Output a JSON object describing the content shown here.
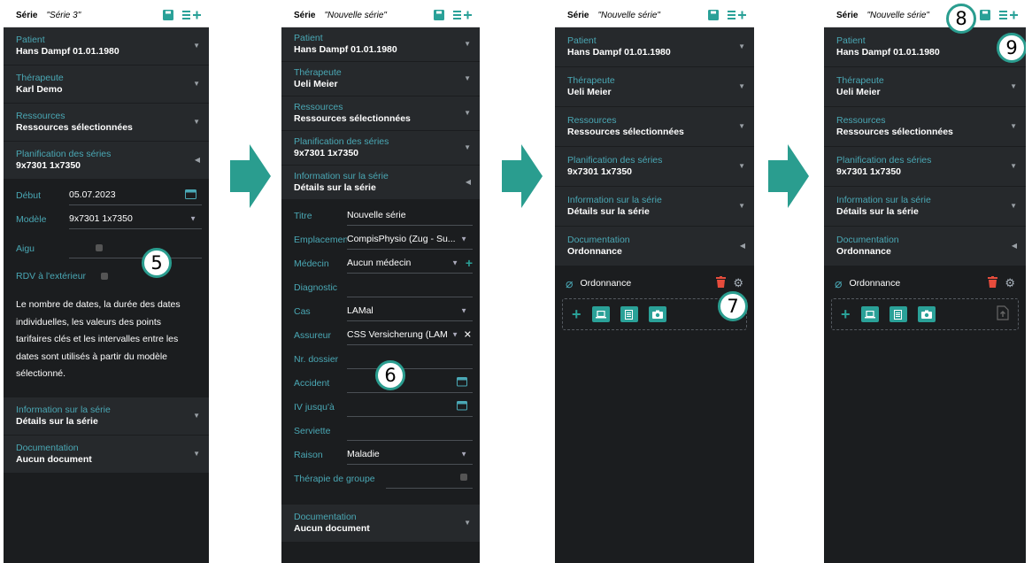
{
  "series_label": "Série",
  "panels": {
    "p1": {
      "series_name": "\"Série 3\"",
      "patient": {
        "title": "Patient",
        "value": "Hans Dampf   01.01.1980"
      },
      "therapist": {
        "title": "Thérapeute",
        "value": "Karl Demo"
      },
      "resources": {
        "title": "Ressources",
        "value": "Ressources sélectionnées"
      },
      "planning": {
        "title": "Planification des séries",
        "value": "9x7301 1x7350"
      },
      "start": {
        "label": "Début",
        "value": "05.07.2023"
      },
      "model": {
        "label": "Modèle",
        "value": "9x7301 1x7350"
      },
      "acute": {
        "label": "Aigu"
      },
      "outside": {
        "label": "RDV à l'extérieur"
      },
      "description": "Le nombre de dates, la durée des dates individuelles, les valeurs des points tarifaires clés et les intervalles entre les dates sont utilisés à partir du modèle sélectionné.",
      "info": {
        "title": "Information sur la série",
        "value": "Détails sur la série"
      },
      "documentation": {
        "title": "Documentation",
        "value": "Aucun document"
      },
      "badge": "5"
    },
    "p2": {
      "series_name": "\"Nouvelle série\"",
      "patient": {
        "title": "Patient",
        "value": "Hans Dampf   01.01.1980"
      },
      "therapist": {
        "title": "Thérapeute",
        "value": "Ueli  Meier"
      },
      "resources": {
        "title": "Ressources",
        "value": "Ressources sélectionnées"
      },
      "planning": {
        "title": "Planification des séries",
        "value": "9x7301 1x7350"
      },
      "info": {
        "title": "Information sur la série",
        "value": "Détails sur la série"
      },
      "fields": [
        {
          "label": "Titre",
          "value": "Nouvelle série"
        },
        {
          "label": "Emplacement",
          "value": "CompisPhysio (Zug - Su..."
        },
        {
          "label": "Médecin",
          "value": "Aucun médecin"
        },
        {
          "label": "Diagnostic",
          "value": ""
        },
        {
          "label": "Cas",
          "value": "LAMal"
        },
        {
          "label": "Assureur",
          "value": "CSS Versicherung (LAM"
        },
        {
          "label": "Nr. dossier",
          "value": ""
        },
        {
          "label": "Accident",
          "value": ""
        },
        {
          "label": "IV jusqu'à",
          "value": ""
        },
        {
          "label": "Serviette",
          "value": ""
        },
        {
          "label": "Raison",
          "value": "Maladie"
        },
        {
          "label": "Thérapie de groupe",
          "value": ""
        }
      ],
      "documentation": {
        "title": "Documentation",
        "value": "Aucun document"
      },
      "badge": "6"
    },
    "p3": {
      "series_name": "\"Nouvelle série\"",
      "patient": {
        "title": "Patient",
        "value": "Hans Dampf   01.01.1980"
      },
      "therapist": {
        "title": "Thérapeute",
        "value": "Ueli  Meier"
      },
      "resources": {
        "title": "Ressources",
        "value": "Ressources sélectionnées"
      },
      "planning": {
        "title": "Planification des séries",
        "value": "9x7301 1x7350"
      },
      "info": {
        "title": "Information sur la série",
        "value": "Détails sur la série"
      },
      "documentation": {
        "title": "Documentation",
        "value": "Ordonnance"
      },
      "doc_name": "Ordonnance",
      "badge": "7"
    },
    "p4": {
      "series_name": "\"Nouvelle série\"",
      "patient": {
        "title": "Patient",
        "value": "Hans Dampf   01.01.1980"
      },
      "therapist": {
        "title": "Thérapeute",
        "value": "Ueli  Meier"
      },
      "resources": {
        "title": "Ressources",
        "value": "Ressources sélectionnées"
      },
      "planning": {
        "title": "Planification des séries",
        "value": "9x7301 1x7350"
      },
      "info": {
        "title": "Information sur la série",
        "value": "Détails sur la série"
      },
      "documentation": {
        "title": "Documentation",
        "value": "Ordonnance"
      },
      "doc_name": "Ordonnance",
      "badge_save": "8",
      "badge_add": "9"
    }
  },
  "colors": {
    "accent": "#2aa198",
    "panel_bg": "#1b1d1f",
    "accordion_bg": "#26292c",
    "label": "#4aa8b5",
    "delete": "#e74c3c",
    "arrow": "#2a9d8f"
  }
}
